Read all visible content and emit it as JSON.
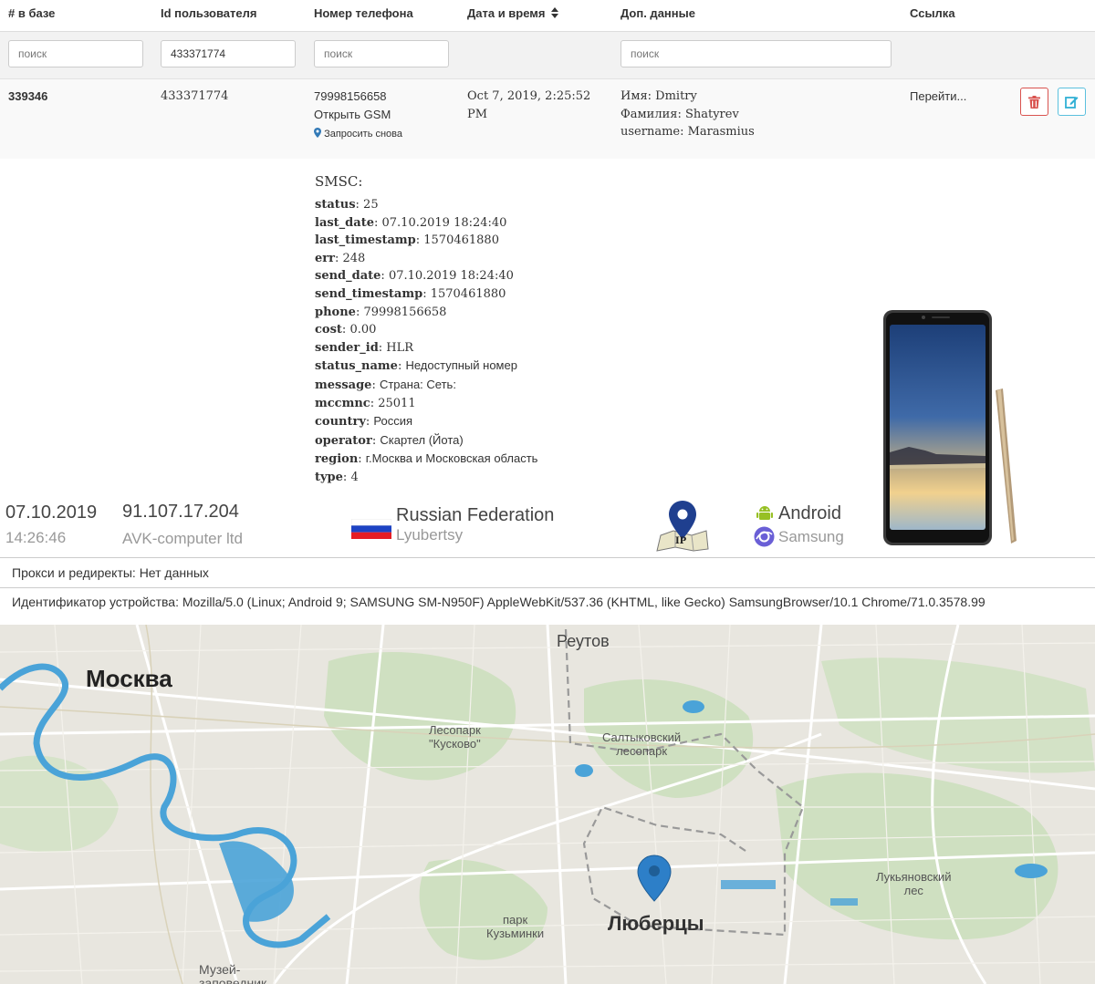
{
  "table": {
    "headers": {
      "db_id": "# в базе",
      "user_id": "Id пользователя",
      "phone": "Номер телефона",
      "datetime": "Дата и время",
      "sort_icon": "sort-icon",
      "extra": "Доп. данные",
      "link": "Ссылка"
    },
    "filters": {
      "db_id_placeholder": "поиск",
      "user_id_value": "433371774",
      "phone_placeholder": "поиск",
      "extra_placeholder": "поиск"
    },
    "row": {
      "db_id": "339346",
      "user_id": "433371774",
      "phone": "79998156658",
      "open_gsm": "Открыть GSM",
      "request_again": "Запросить снова",
      "datetime": "Oct 7, 2019, 2:25:52 PM",
      "first_name": "Имя: Dmitry",
      "last_name": "Фамилия: Shatyrev",
      "username": "username: Marasmius",
      "link_text": "Перейти...",
      "delete_icon": "trash-icon",
      "edit_icon": "edit-icon"
    }
  },
  "smsc": {
    "title": "SMSC:",
    "fields": [
      {
        "key": "status",
        "value": "25"
      },
      {
        "key": "last_date",
        "value": "07.10.2019 18:24:40"
      },
      {
        "key": "last_timestamp",
        "value": "1570461880"
      },
      {
        "key": "err",
        "value": "248"
      },
      {
        "key": "send_date",
        "value": "07.10.2019 18:24:40"
      },
      {
        "key": "send_timestamp",
        "value": "1570461880"
      },
      {
        "key": "phone",
        "value": "79998156658"
      },
      {
        "key": "cost",
        "value": "0.00"
      },
      {
        "key": "sender_id",
        "value": "HLR"
      },
      {
        "key": "status_name",
        "value": "Недоступный номер"
      },
      {
        "key": "message",
        "value": "Страна: Сеть:"
      },
      {
        "key": "mccmnc",
        "value": "25011"
      },
      {
        "key": "country",
        "value": "Россия"
      },
      {
        "key": "operator",
        "value": "Скартел (Йота)"
      },
      {
        "key": "region",
        "value": "г.Москва и Московская область"
      },
      {
        "key": "type",
        "value": "4"
      }
    ]
  },
  "visit": {
    "date": "07.10.2019",
    "time": "14:26:46",
    "ip": "91.107.17.204",
    "isp": "AVK-computer ltd",
    "country": "Russian Federation",
    "city": "Lyubertsy",
    "ip_map_label": "IP",
    "os": "Android",
    "browser": "Samsung"
  },
  "proxy": "Прокси и редиректы: Нет данных",
  "device_id": "Идентификатор устройства: Mozilla/5.0 (Linux; Android 9; SAMSUNG SM-N950F) AppleWebKit/537.36 (KHTML, like Gecko) SamsungBrowser/10.1 Chrome/71.0.3578.99",
  "map": {
    "labels": {
      "moscow": "Москва",
      "reutov": "Реутов",
      "kuskovo": "Лесопарк\n\"Кусково\"",
      "saltykovsky": "Салтыковский\nлесопарк",
      "lukyanovsky": "Лукьяновский\nлес",
      "kuzminki": "парк\nКузьминки",
      "lyubertsy": "Люберцы",
      "museum": "Музей-\nзаповедник"
    }
  },
  "colors": {
    "link": "#337ab7",
    "danger": "#d9534f",
    "info": "#5bc0de",
    "map_bg": "#e8e6df",
    "water": "#4aa3d8",
    "marker": "#2d7fc8",
    "android": "#97c024"
  }
}
